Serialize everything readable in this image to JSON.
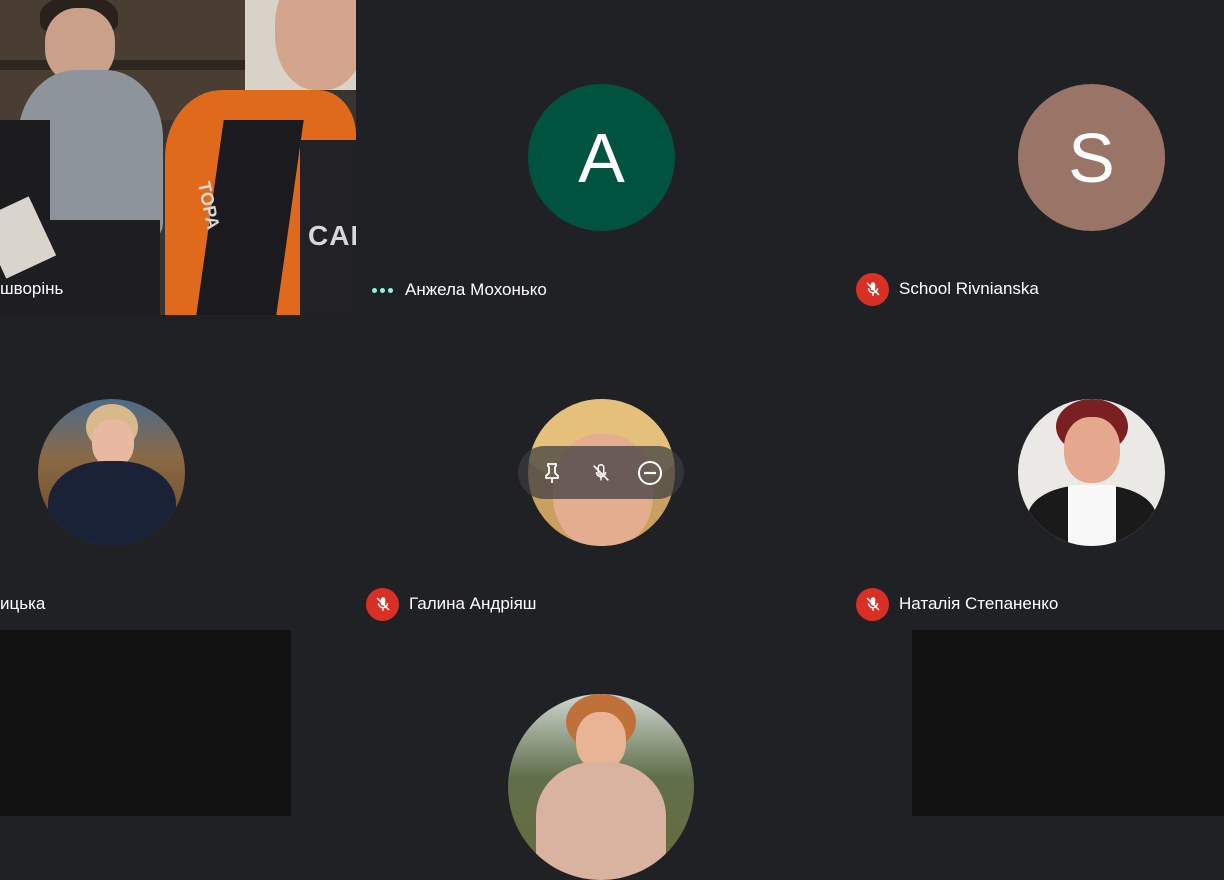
{
  "participants": [
    {
      "name": "шворінь",
      "type": "video"
    },
    {
      "name": "Анжела Мохонько",
      "avatar_letter": "A",
      "avatar_color": "#00533f",
      "status": "speaking-dots"
    },
    {
      "name": "School Rivnianska",
      "avatar_letter": "S",
      "avatar_color": "#9a7567",
      "status": "muted"
    },
    {
      "name": "ицька",
      "type": "photo",
      "status": "unknown"
    },
    {
      "name": "Галина Андріяш",
      "type": "photo",
      "status": "muted"
    },
    {
      "name": "Наталія Степаненко",
      "type": "photo",
      "status": "muted"
    },
    {
      "name": "",
      "type": "photo"
    }
  ],
  "video_overlay_text": {
    "logo_1": "CAL",
    "logo_2": "TOPA"
  },
  "hover_controls": {
    "pin": "pin-icon",
    "mute": "mic-off-icon",
    "remove": "remove-icon"
  },
  "colors": {
    "background": "#202124",
    "muted_badge": "#d93025",
    "dots": "#8ff1e8",
    "dark_tile": "#121212"
  }
}
